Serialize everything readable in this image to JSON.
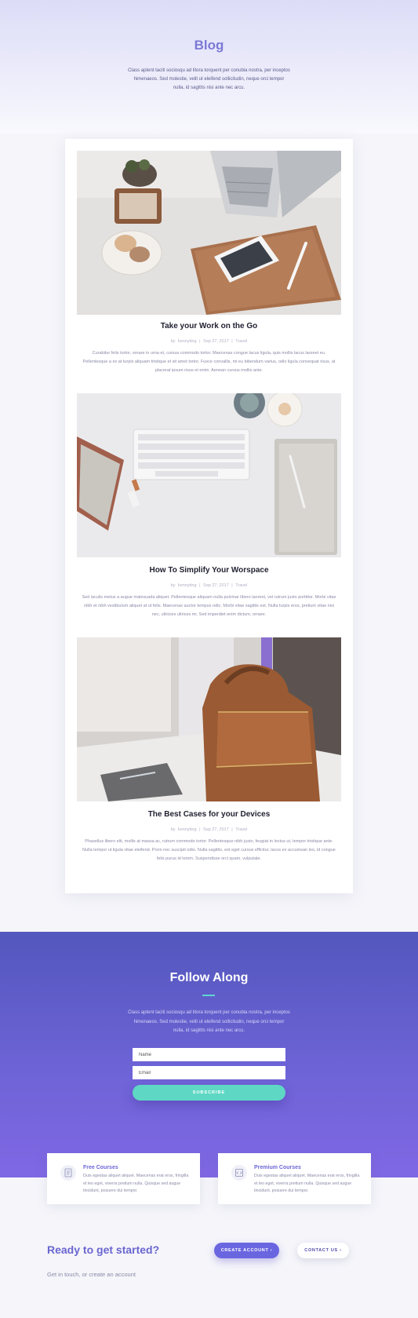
{
  "hero": {
    "title": "Blog",
    "text": "Class aptent taciti sociosqu ad litora torquent per conubia nostra, per inceptos himenaeos. Sed molestie, velit ut eleifend sollicitudin, neque orci tempor nulla, id sagittis nisi ante nec arcu."
  },
  "posts": [
    {
      "title": "Take your Work on the Go",
      "author": "kennyting",
      "date": "Sep 27, 2017",
      "category": "Travel",
      "excerpt": "Curabitur felis tortor, ornare in urna et, cursus commodo tortor. Maecenas congue lacus ligula, quis mollis lacus laoreet eu. Pellentesque a ex at turpis aliquam tristique et sit amet tortor. Fusce convallis, mi eu bibendum varius, odio ligula consequat risus, at placerat ipsum risus et enim. Aenean cursus mollis ante."
    },
    {
      "title": "How To Simplify Your Worspace",
      "author": "kennyting",
      "date": "Sep 27, 2017",
      "category": "Travel",
      "excerpt": "Sed iaculis metus a augue malesuada aliquet. Pellentesque aliquam nulla pulvinar libero laoreet, vel rutrum justo porttitor. Morbi vitae nibh et nibh vestibulum aliquet at ut felis. Maecenas auctor tempus odio. Morbi vitae sagittis est. Nulla turpis eros, pretium vitae nisi nec, ultricies ultrices mi. Sed imperdiet enim dictum, ornare."
    },
    {
      "title": "The Best Cases for your Devices",
      "author": "kennyting",
      "date": "Sep 27, 2017",
      "category": "Travel",
      "excerpt": "Phasellus libero elit, mollis at massa ac, rutrum commodo tortor. Pellentesque nibh justo, feugiat in lectus ut, tempor tristique ante. Nulla tempor ut ligula vitae eleifend. Proin nec suscipit odio. Nulla sagittis, est eget cursus efficitur, lacus ex accumsan leo, id congue felis purus id lorem. Suspendisse orci quam, vulputate."
    }
  ],
  "meta_separator": "|",
  "meta_prefix": "by",
  "follow": {
    "title": "Follow Along",
    "text": "Class aptent taciti sociosqu ad litora torquent per conubia nostra, per inceptos himenaeos. Sed molestie, velit ut eleifend sollicitudin, neque orci tempor nulla, id sagittis nisi ante nec arcu.",
    "name_placeholder": "Name",
    "email_placeholder": "Email",
    "subscribe_label": "SUBSCRIBE"
  },
  "courses": [
    {
      "title": "Free Courses",
      "icon": "document-icon",
      "text": "Duis egestas aliquet aliquet. Maecenas erat eros, fringilla et leo eget, viverra pretium nulla. Quisque sed augue tincidunt, posuere dui tempor."
    },
    {
      "title": "Premium Courses",
      "icon": "code-file-icon",
      "text": "Duis egestas aliquet aliquet. Maecenas erat eros, fringilla et leo eget, viverra pretium nulla. Quisque sed augue tincidunt, posuere dui tempor."
    }
  ],
  "cta": {
    "title": "Ready to get started?",
    "subtitle": "Get in touch, or create an account",
    "create_label": "CREATE ACCOUNT",
    "contact_label": "CONTACT US"
  },
  "colors": {
    "accent": "#6a66d0",
    "teal": "#5ed8c4",
    "band_top": "#5357bd",
    "band_bottom": "#8068e4"
  }
}
